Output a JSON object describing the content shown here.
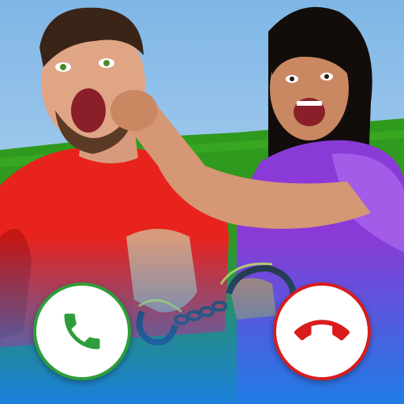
{
  "colors": {
    "accept": "#2e9e3a",
    "decline": "#d91c1c",
    "sky": "#9cc8ea",
    "grass": "#2f9a1e",
    "bottom_gradient": "#1a7fe6"
  },
  "icons": {
    "accept": "phone-accept-icon",
    "decline": "phone-decline-icon"
  }
}
